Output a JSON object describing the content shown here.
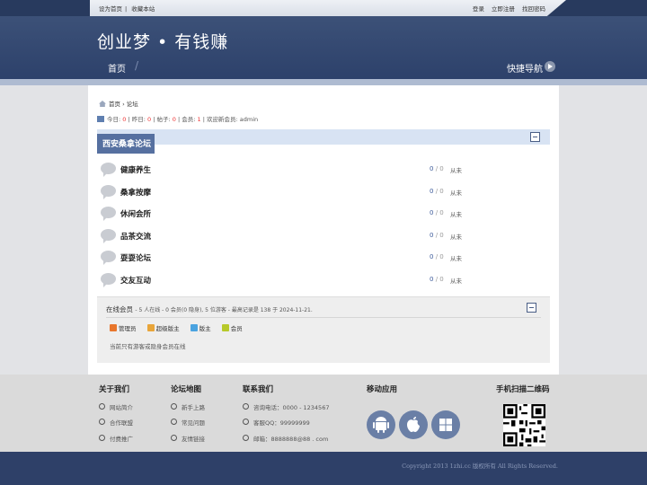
{
  "topbar": {
    "set_home": "设为首页",
    "separator": "|",
    "bookmark": "收藏本站",
    "login": "登录",
    "register": "立即注册",
    "forgot": "找回密码"
  },
  "header": {
    "logo": "创业梦 • 有钱赚",
    "nav_home": "首页",
    "nav_sep": "/",
    "quick_nav": "快捷导航"
  },
  "breadcrumb": {
    "home": "首页",
    "arrow": "›",
    "current": "论坛"
  },
  "stats": {
    "today_label": "今日:",
    "today": "0",
    "yesterday_label": "昨日:",
    "yesterday": "0",
    "posts_label": "帖子:",
    "posts": "0",
    "members_label": "会员:",
    "members": "1",
    "welcome": "欢迎新会员:",
    "newest": "admin"
  },
  "forum_group": {
    "title": "西安桑拿论坛",
    "forums": [
      {
        "name": "健康养生",
        "threads": "0",
        "sep": "/",
        "posts": "0",
        "last": "从未"
      },
      {
        "name": "桑拿按摩",
        "threads": "0",
        "sep": "/",
        "posts": "0",
        "last": "从未"
      },
      {
        "name": "休闲会所",
        "threads": "0",
        "sep": "/",
        "posts": "0",
        "last": "从未"
      },
      {
        "name": "品茶交流",
        "threads": "0",
        "sep": "/",
        "posts": "0",
        "last": "从未"
      },
      {
        "name": "耍耍论坛",
        "threads": "0",
        "sep": "/",
        "posts": "0",
        "last": "从未"
      },
      {
        "name": "交友互动",
        "threads": "0",
        "sep": "/",
        "posts": "0",
        "last": "从未"
      }
    ]
  },
  "online": {
    "title": "在线会员",
    "summary": "- 5 人在线 - 0 会员(0 隐身), 5 位游客 - 最高记录是 138 于 2024-11-21.",
    "legend": [
      {
        "label": "管理员",
        "color": "#e8762c"
      },
      {
        "label": "超级版主",
        "color": "#e8a53a"
      },
      {
        "label": "版主",
        "color": "#4aa3e0"
      },
      {
        "label": "会员",
        "color": "#b7c92a"
      }
    ],
    "note": "当前只有游客或隐身会员在线"
  },
  "footer": {
    "about": {
      "title": "关于我们",
      "items": [
        "网站简介",
        "合作联盟",
        "付费推广"
      ]
    },
    "sitemap": {
      "title": "论坛地图",
      "items": [
        "新手上路",
        "常见问题",
        "友情链接"
      ]
    },
    "contact": {
      "title": "联系我们",
      "items": [
        "咨询电话：0000 - 1234567",
        "客服QQ：99999999",
        "邮箱：8888888@88 . com"
      ]
    },
    "mobile": {
      "title": "移动应用",
      "apps": [
        "android-icon",
        "apple-icon",
        "windows-icon"
      ]
    },
    "qr": {
      "title": "手机扫描二维码"
    }
  },
  "copyright": "Copyright 2013 1zhi.cc 版权所有 All Rights Reserved.",
  "colors": {
    "header": "#34497a",
    "accent": "#5670a0",
    "footer_bar": "#2e4068"
  }
}
